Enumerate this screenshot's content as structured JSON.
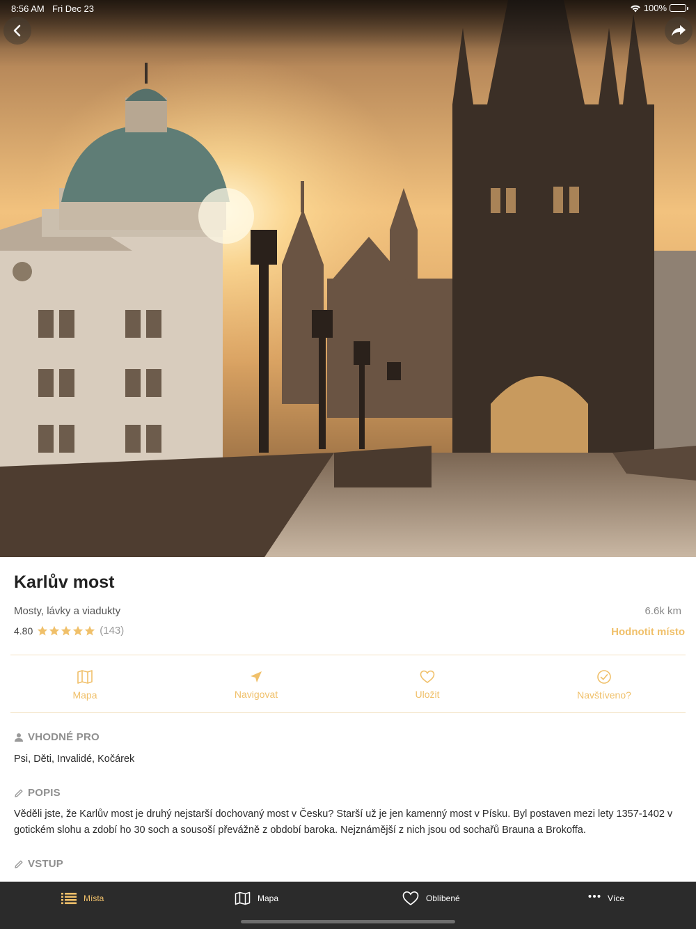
{
  "status_bar": {
    "time": "8:56 AM",
    "date": "Fri Dec 23",
    "battery": "100%"
  },
  "place": {
    "title": "Karlův most",
    "category": "Mosty, lávky a viadukty",
    "distance": "6.6k km",
    "rating": "4.80",
    "stars": 5,
    "rating_count": "(143)",
    "rate_action": "Hodnotit místo"
  },
  "actions": {
    "map": "Mapa",
    "navigate": "Navigovat",
    "save": "Uložit",
    "visited": "Navštíveno?"
  },
  "sections": {
    "suitable_heading": "VHODNÉ PRO",
    "suitable_text": "Psi, Děti, Invalidé, Kočárek",
    "description_heading": "POPIS",
    "description_text": "Věděli jste, že Karlův most je druhý nejstarší dochovaný most v Česku? Starší už je jen kamenný most v Písku. Byl postaven mezi lety 1357-1402 v gotickém slohu a zdobí ho 30 soch a sousoší převážně z období baroka. Nejznámější z nich jsou od sochařů Brauna a Brokoffa.",
    "entry_heading": "VSTUP"
  },
  "tabs": {
    "places": "Místa",
    "map": "Mapa",
    "favorites": "Oblíbené",
    "more": "Více"
  },
  "colors": {
    "accent": "#f0c06a",
    "tab_bar": "#2b2b2b"
  },
  "icons": [
    "back-icon",
    "share-icon",
    "wifi-icon",
    "battery-icon",
    "star-icon",
    "map-icon",
    "navigate-icon",
    "heart-icon",
    "check-circle-icon",
    "person-icon",
    "pencil-icon",
    "list-icon",
    "dots-icon"
  ]
}
